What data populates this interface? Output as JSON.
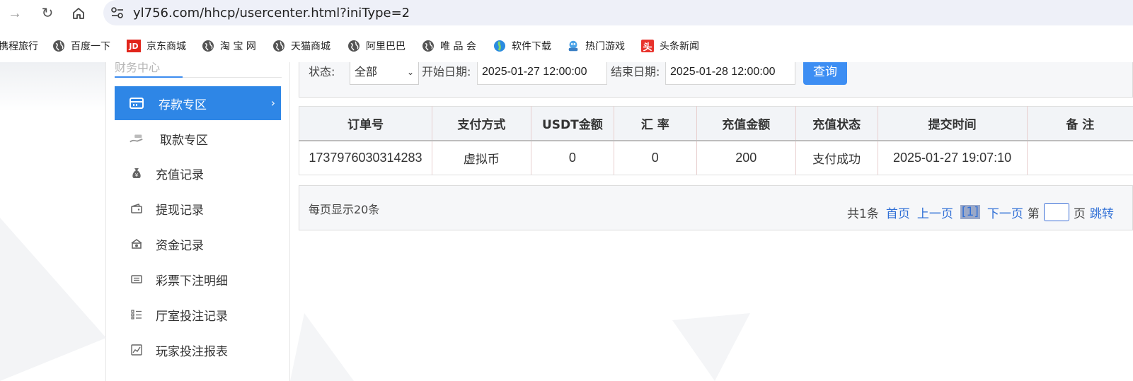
{
  "browser": {
    "url": "yl756.com/hhcp/usercenter.html?iniType=2"
  },
  "bookmarks": [
    {
      "label": "携程旅行",
      "icon": "none"
    },
    {
      "label": "百度一下",
      "icon": "globe-icon"
    },
    {
      "label": "京东商城",
      "icon": "jd-logo-icon"
    },
    {
      "label": "淘 宝 网",
      "icon": "globe-icon"
    },
    {
      "label": "天猫商城",
      "icon": "globe-icon"
    },
    {
      "label": "阿里巴巴",
      "icon": "globe-icon"
    },
    {
      "label": "唯 品 会",
      "icon": "globe-icon"
    },
    {
      "label": "软件下载",
      "icon": "download-icon"
    },
    {
      "label": "热门游戏",
      "icon": "game-icon"
    },
    {
      "label": "头条新闻",
      "icon": "toutiao-icon"
    }
  ],
  "bookmark_jd_text": "JD",
  "bookmark_toutiao_text": "头",
  "sidebar": {
    "header_ghost": "财务中心",
    "items": [
      {
        "label": "存款专区",
        "active": true,
        "icon": "deposit-icon"
      },
      {
        "label": "取款专区",
        "active": false,
        "icon": "withdraw-icon"
      },
      {
        "label": "充值记录",
        "active": false,
        "icon": "money-bag-icon"
      },
      {
        "label": "提现记录",
        "active": false,
        "icon": "wallet-icon"
      },
      {
        "label": "资金记录",
        "active": false,
        "icon": "fund-icon"
      },
      {
        "label": "彩票下注明细",
        "active": false,
        "icon": "ticket-icon"
      },
      {
        "label": "厅室投注记录",
        "active": false,
        "icon": "list-icon"
      },
      {
        "label": "玩家投注报表",
        "active": false,
        "icon": "chart-icon"
      }
    ],
    "active_chevron": "›"
  },
  "filters": {
    "status_label": "状态:",
    "status_value": "全部",
    "start_label": "开始日期:",
    "start_value": "2025-01-27 12:00:00",
    "end_label": "结束日期:",
    "end_value": "2025-01-28 12:00:00",
    "query_button": "查询"
  },
  "table": {
    "columns": [
      "订单号",
      "支付方式",
      "USDT金额",
      "汇 率",
      "充值金额",
      "充值状态",
      "提交时间",
      "备 注"
    ],
    "rows": [
      [
        "1737976030314283",
        "虚拟币",
        "0",
        "0",
        "200",
        "支付成功",
        "2025-01-27 19:07:10",
        ""
      ]
    ]
  },
  "pager": {
    "per_page": "每页显示20条",
    "total": "共1条",
    "first": "首页",
    "prev": "上一页",
    "current": "[1]",
    "next": "下一页",
    "goto_prefix": "第",
    "goto_suffix": "页",
    "jump": "跳转"
  },
  "colors": {
    "accent": "#2e86e6",
    "link": "#2f6fd6",
    "button": "#3d8ef3"
  }
}
